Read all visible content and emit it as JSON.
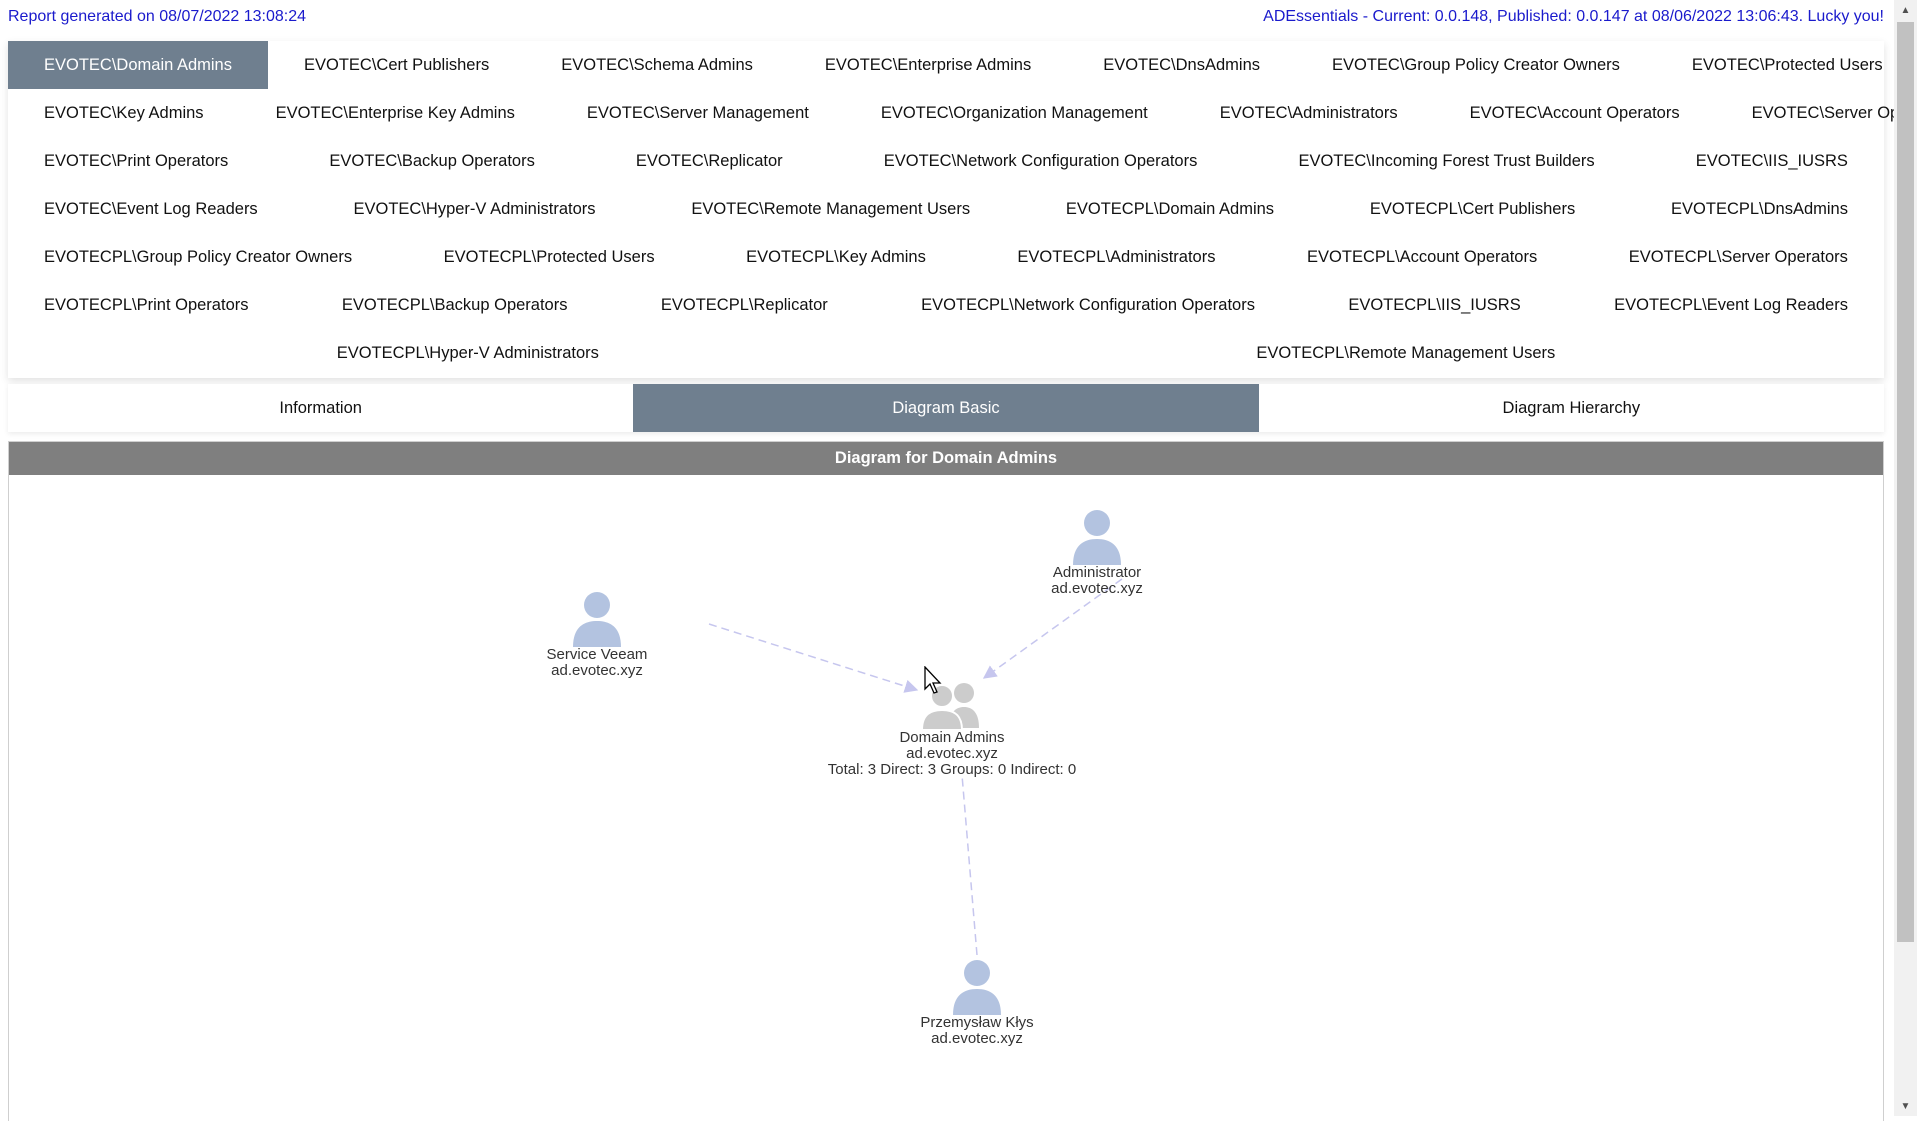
{
  "header": {
    "report_generated": "Report generated on 08/07/2022 13:08:24",
    "version_info": "ADEssentials - Current: 0.0.148, Published: 0.0.147 at 08/06/2022 13:06:43. Lucky you!"
  },
  "group_tabs": [
    [
      "EVOTEC\\Domain Admins",
      "EVOTEC\\Cert Publishers",
      "EVOTEC\\Schema Admins",
      "EVOTEC\\Enterprise Admins",
      "EVOTEC\\DnsAdmins",
      "EVOTEC\\Group Policy Creator Owners",
      "EVOTEC\\Protected Users"
    ],
    [
      "EVOTEC\\Key Admins",
      "EVOTEC\\Enterprise Key Admins",
      "EVOTEC\\Server Management",
      "EVOTEC\\Organization Management",
      "EVOTEC\\Administrators",
      "EVOTEC\\Account Operators",
      "EVOTEC\\Server Operators"
    ],
    [
      "EVOTEC\\Print Operators",
      "EVOTEC\\Backup Operators",
      "EVOTEC\\Replicator",
      "EVOTEC\\Network Configuration Operators",
      "EVOTEC\\Incoming Forest Trust Builders",
      "EVOTEC\\IIS_IUSRS"
    ],
    [
      "EVOTEC\\Event Log Readers",
      "EVOTEC\\Hyper-V Administrators",
      "EVOTEC\\Remote Management Users",
      "EVOTECPL\\Domain Admins",
      "EVOTECPL\\Cert Publishers",
      "EVOTECPL\\DnsAdmins"
    ],
    [
      "EVOTECPL\\Group Policy Creator Owners",
      "EVOTECPL\\Protected Users",
      "EVOTECPL\\Key Admins",
      "EVOTECPL\\Administrators",
      "EVOTECPL\\Account Operators",
      "EVOTECPL\\Server Operators"
    ],
    [
      "EVOTECPL\\Print Operators",
      "EVOTECPL\\Backup Operators",
      "EVOTECPL\\Replicator",
      "EVOTECPL\\Network Configuration Operators",
      "EVOTECPL\\IIS_IUSRS",
      "EVOTECPL\\Event Log Readers"
    ],
    [
      "EVOTECPL\\Hyper-V Administrators",
      "EVOTECPL\\Remote Management Users"
    ]
  ],
  "active_group_tab": "EVOTEC\\Domain Admins",
  "view_tabs": [
    "Information",
    "Diagram Basic",
    "Diagram Hierarchy"
  ],
  "active_view_tab": "Diagram Basic",
  "panel": {
    "title": "Diagram for Domain Admins"
  },
  "diagram": {
    "nodes": {
      "administrator": {
        "name": "Administrator",
        "domain": "ad.evotec.xyz"
      },
      "service_veeam": {
        "name": "Service Veeam",
        "domain": "ad.evotec.xyz"
      },
      "domain_admins": {
        "name": "Domain Admins",
        "domain": "ad.evotec.xyz",
        "stats": "Total: 3 Direct: 3 Groups: 0 Indirect: 0"
      },
      "przemyslaw": {
        "name": "Przemysław Kłys",
        "domain": "ad.evotec.xyz"
      }
    },
    "user_icon_color": "#b3c3e0",
    "group_icon_color": "#cccccc",
    "edge_color": "#c6c6ee"
  },
  "scrollbar": {
    "up_icon": "triangle-up",
    "down_icon": "triangle-down"
  }
}
